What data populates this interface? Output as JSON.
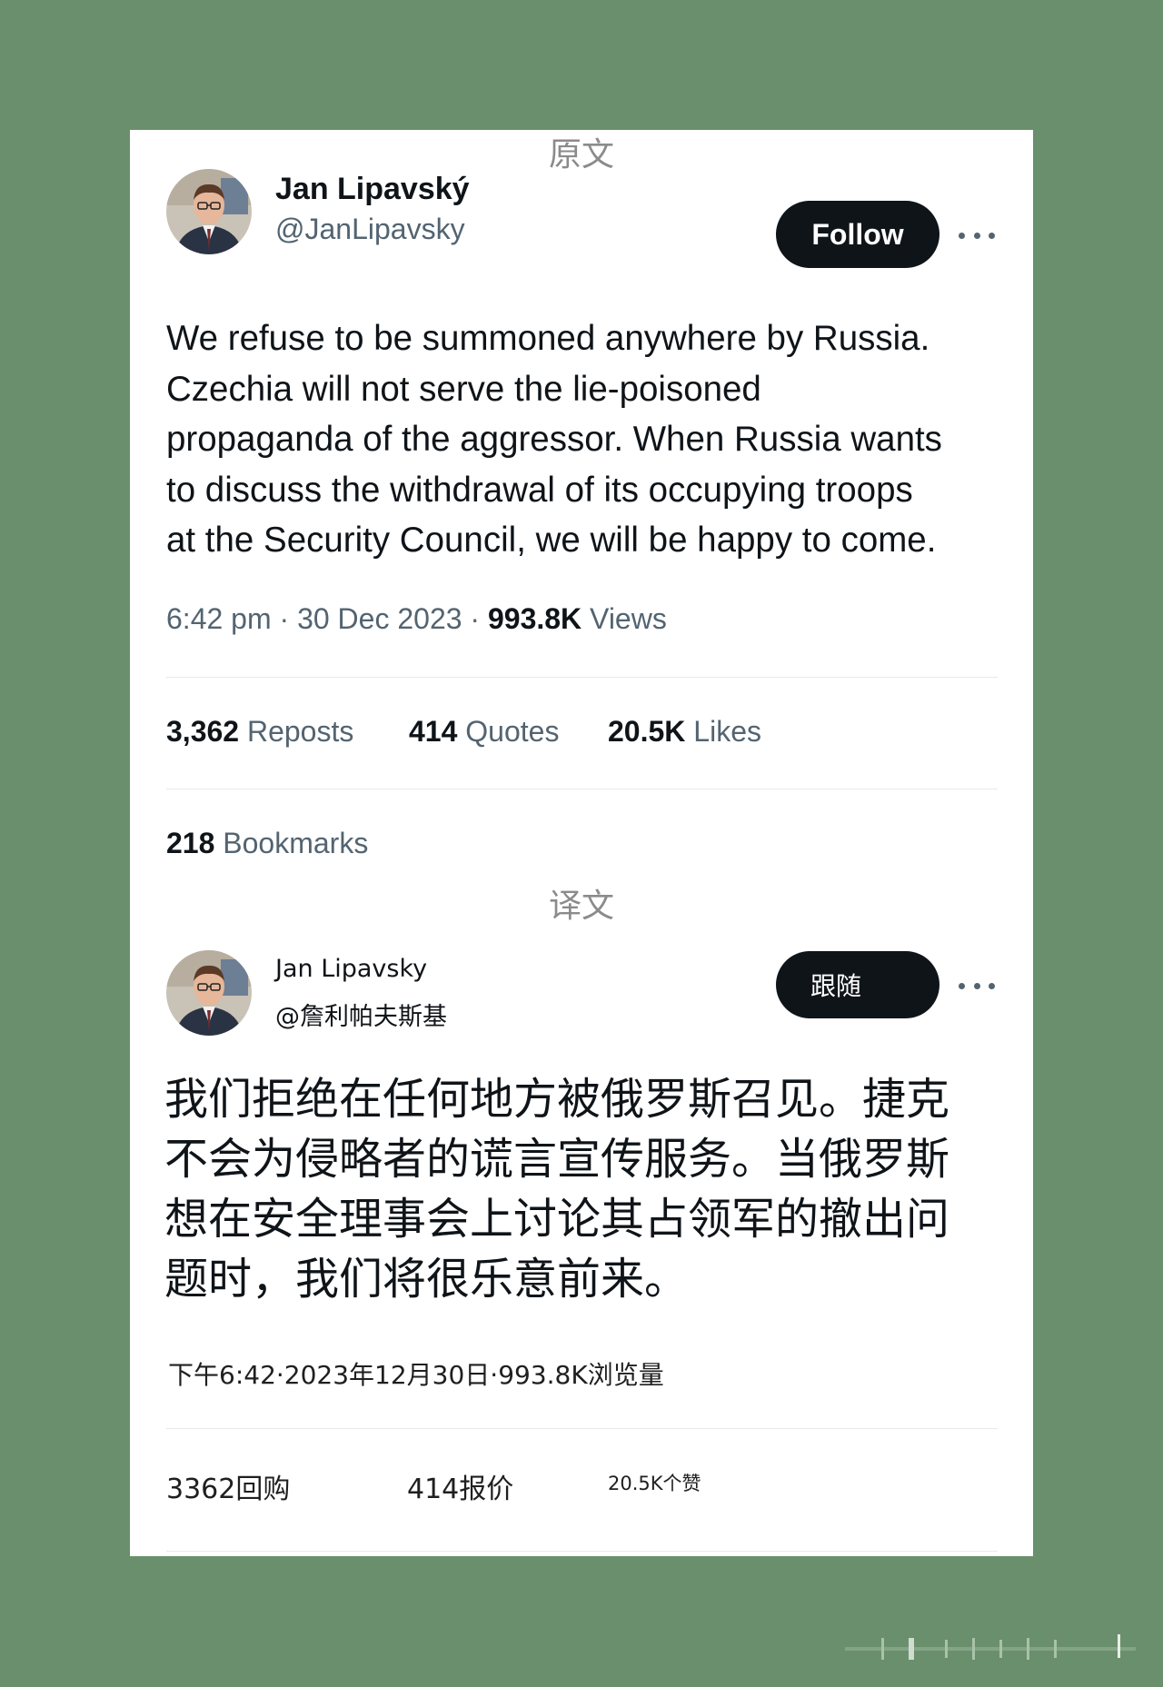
{
  "labels": {
    "original": "原文",
    "translation": "译文"
  },
  "original_tweet": {
    "author_name": "Jan Lipavský",
    "handle": "@JanLipavsky",
    "follow_label": "Follow",
    "text_lines": [
      "We refuse to be summoned anywhere by Russia.",
      "Czechia will not serve the lie-poisoned",
      "propaganda of the aggressor. When Russia wants",
      "to discuss the withdrawal of its occupying troops",
      "at the Security Council, we will be happy to come."
    ],
    "time": "6:42 pm",
    "date": "30 Dec 2023",
    "separator": "·",
    "views_count": "993.8K",
    "views_label": "Views",
    "stats": {
      "reposts_count": "3,362",
      "reposts_label": "Reposts",
      "quotes_count": "414",
      "quotes_label": "Quotes",
      "likes_count": "20.5K",
      "likes_label": "Likes",
      "bookmarks_count": "218",
      "bookmarks_label": "Bookmarks"
    }
  },
  "translated_tweet": {
    "author_name": "Jan Lipavsky",
    "handle": "@詹利帕夫斯基",
    "follow_label": "跟随",
    "text_lines": [
      "我们拒绝在任何地方被俄罗斯召见。捷克",
      "不会为侵略者的谎言宣传服务。当俄罗斯",
      "想在安全理事会上讨论其占领军的撤出问",
      "题时，我们将很乐意前来。"
    ],
    "meta": "下午6:42·2023年12月30日·993.8K浏览量",
    "stats": {
      "reposts": "3362回购",
      "quotes": "414报价",
      "likes": "20.5K个赞"
    }
  },
  "icons": {
    "more": "more-horizontal-icon",
    "avatar": "avatar-photo"
  },
  "colors": {
    "background": "#6a8f6c",
    "card": "#ffffff",
    "button": "#0f1419",
    "secondary_text": "#536471"
  }
}
